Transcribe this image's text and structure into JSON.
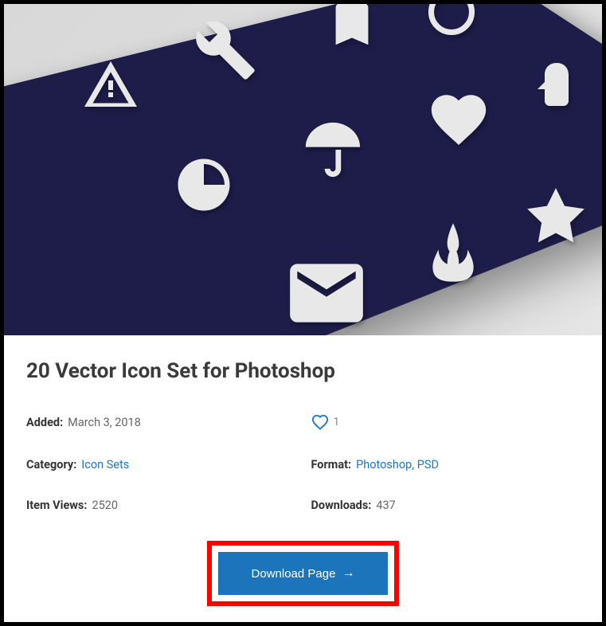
{
  "title": "20 Vector Icon Set for Photoshop",
  "meta": {
    "added_label": "Added:",
    "added_value": "March 3, 2018",
    "category_label": "Category:",
    "category_value": "Icon Sets",
    "item_views_label": "Item Views:",
    "item_views_value": "2520",
    "format_label": "Format:",
    "format_value": "Photoshop, PSD",
    "downloads_label": "Downloads:",
    "downloads_value": "437"
  },
  "likes": {
    "count": "1"
  },
  "download": {
    "label": "Download Page"
  }
}
